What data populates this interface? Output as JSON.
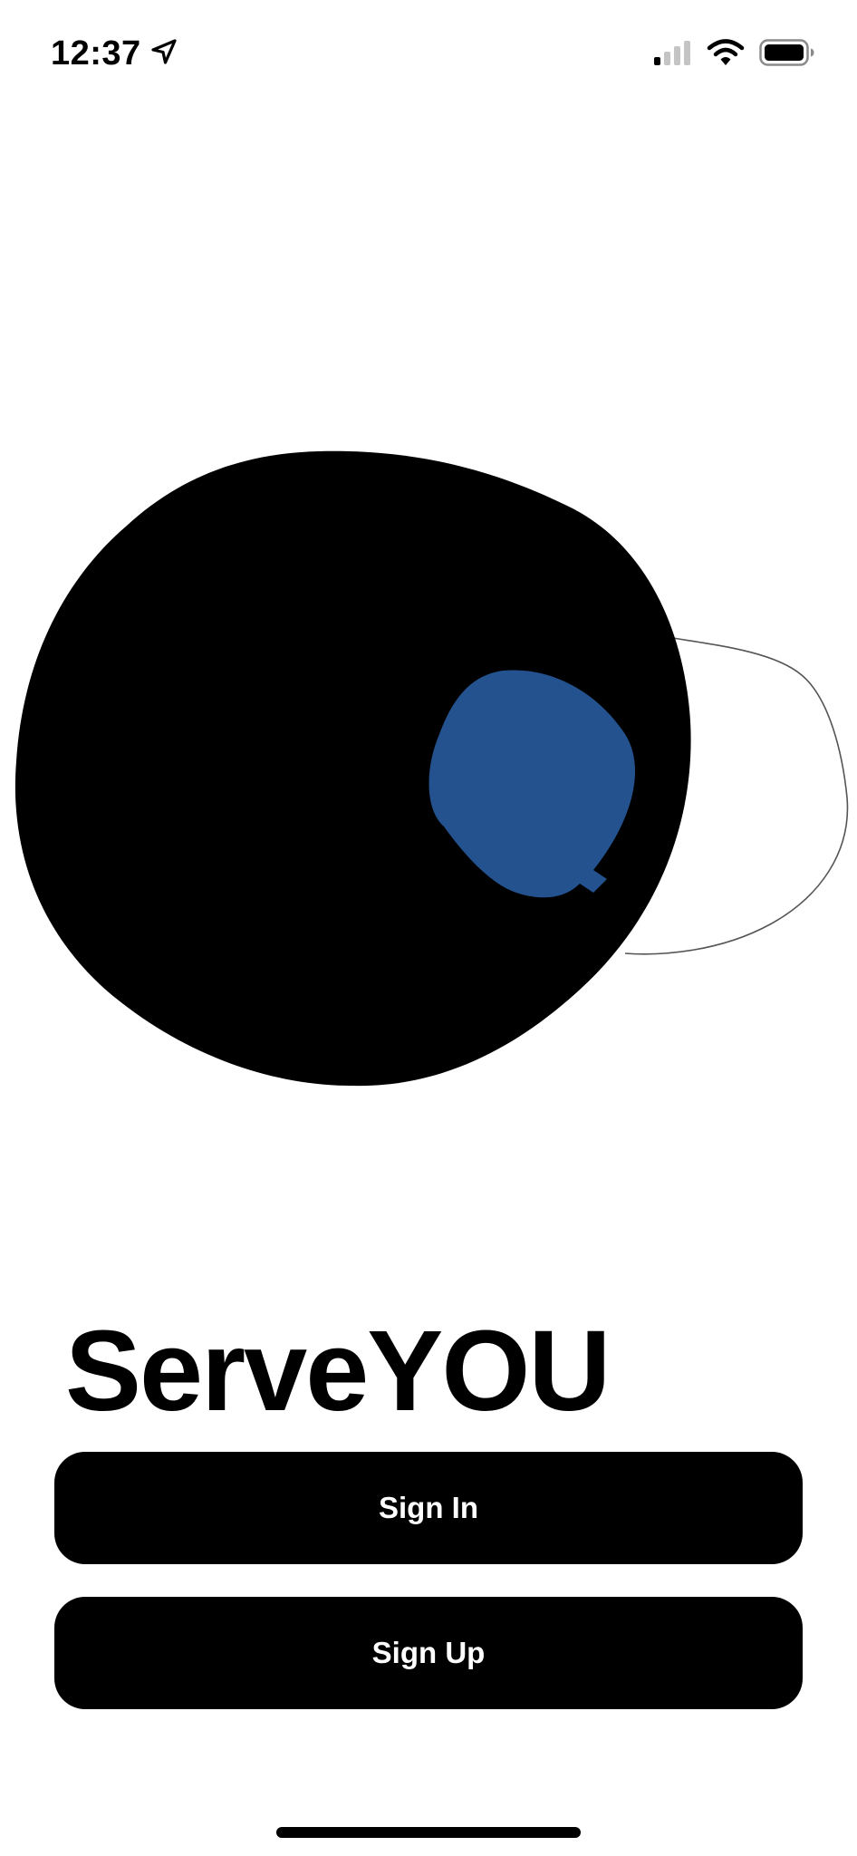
{
  "status_bar": {
    "time": "12:37",
    "location_icon": "location-arrow-icon",
    "signal_icon": "cellular-signal-icon",
    "wifi_icon": "wifi-icon",
    "battery_icon": "battery-icon"
  },
  "hero": {
    "illustration": "abstract-blob-illustration",
    "colors": {
      "primary_blob": "#000000",
      "accent_blob": "#23528e",
      "outline_blob": "#555555"
    }
  },
  "app": {
    "title": "ServeYOU"
  },
  "actions": {
    "sign_in_label": "Sign In",
    "sign_up_label": "Sign Up"
  },
  "colors": {
    "background": "#ffffff",
    "button_bg": "#000000",
    "button_text": "#ffffff"
  }
}
